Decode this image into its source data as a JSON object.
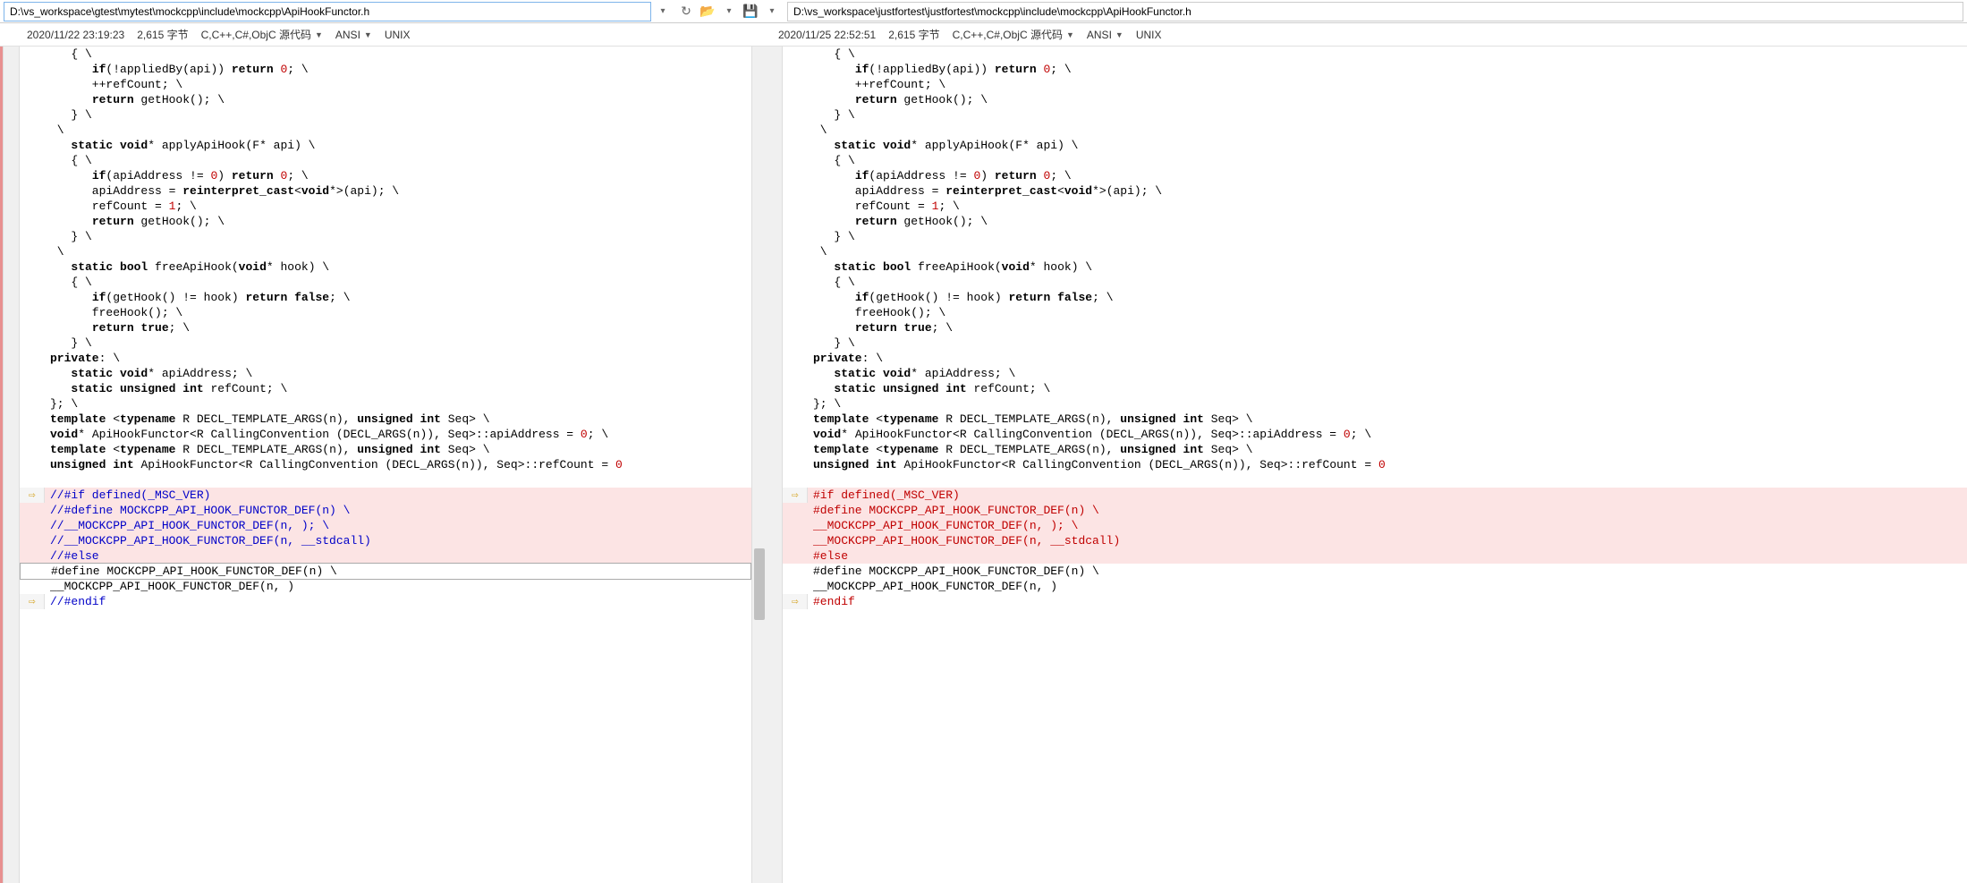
{
  "topbar": {
    "left_path": "D:\\vs_workspace\\gtest\\mytest\\mockcpp\\include\\mockcpp\\ApiHookFunctor.h",
    "right_path": "D:\\vs_workspace\\justfortest\\justfortest\\mockcpp\\include\\mockcpp\\ApiHookFunctor.h"
  },
  "infobar": {
    "left": {
      "timestamp": "2020/11/22 23:19:23",
      "size": "2,615 字节",
      "filetype": "C,C++,C#,ObjC 源代码",
      "encoding": "ANSI",
      "lineending": "UNIX"
    },
    "right": {
      "timestamp": "2020/11/25 22:52:51",
      "size": "2,615 字节",
      "filetype": "C,C++,C#,ObjC 源代码",
      "encoding": "ANSI",
      "lineending": "UNIX"
    }
  },
  "code_left": {
    "common_start": "   { \\\n      if(!appliedBy(api)) return 0; \\\n      ++refCount; \\\n      return getHook(); \\\n   } \\\n \\\n   static void* applyApiHook(F* api) \\\n   { \\\n      if(apiAddress != 0) return 0; \\\n      apiAddress = reinterpret_cast<void*>(api); \\\n      refCount = 1; \\\n      return getHook(); \\\n   } \\\n \\\n   static bool freeApiHook(void* hook) \\\n   { \\\n      if(getHook() != hook) return false; \\\n      freeHook(); \\\n      return true; \\\n   } \\\nprivate: \\\n   static void* apiAddress; \\\n   static unsigned int refCount; \\\n}; \\\ntemplate <typename R DECL_TEMPLATE_ARGS(n), unsigned int Seq> \\\nvoid* ApiHookFunctor<R CallingConvention (DECL_ARGS(n)), Seq>::apiAddress = 0; \\\ntemplate <typename R DECL_TEMPLATE_ARGS(n), unsigned int Seq> \\\nunsigned int ApiHookFunctor<R CallingConvention (DECL_ARGS(n)), Seq>::refCount = 0",
    "diff_lines": [
      "//#if defined(_MSC_VER)",
      "//#define MOCKCPP_API_HOOK_FUNCTOR_DEF(n) \\",
      "//__MOCKCPP_API_HOOK_FUNCTOR_DEF(n, ); \\",
      "//__MOCKCPP_API_HOOK_FUNCTOR_DEF(n, __stdcall)",
      "//#else"
    ],
    "after_lines": [
      "#define MOCKCPP_API_HOOK_FUNCTOR_DEF(n) \\",
      "__MOCKCPP_API_HOOK_FUNCTOR_DEF(n, )"
    ],
    "endif_line": "//#endif"
  },
  "code_right": {
    "diff_lines": [
      "#if defined(_MSC_VER)",
      "#define MOCKCPP_API_HOOK_FUNCTOR_DEF(n) \\",
      "__MOCKCPP_API_HOOK_FUNCTOR_DEF(n, ); \\",
      "__MOCKCPP_API_HOOK_FUNCTOR_DEF(n, __stdcall)",
      "#else"
    ],
    "after_lines": [
      "#define MOCKCPP_API_HOOK_FUNCTOR_DEF(n) \\",
      "__MOCKCPP_API_HOOK_FUNCTOR_DEF(n, )"
    ],
    "endif_line": "#endif"
  }
}
